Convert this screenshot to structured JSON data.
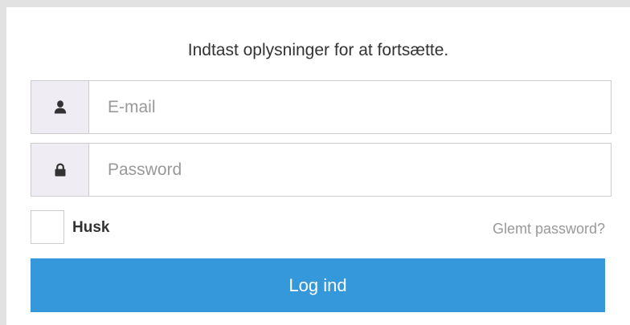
{
  "login": {
    "heading": "Indtast oplysninger for at fortsætte.",
    "email": {
      "placeholder": "E-mail",
      "value": "",
      "icon": "user-icon"
    },
    "password": {
      "placeholder": "Password",
      "value": "",
      "icon": "lock-icon"
    },
    "remember_label": "Husk",
    "remember_checked": false,
    "forgot_label": "Glemt password?",
    "submit_label": "Log ind"
  },
  "colors": {
    "page_background": "#e2e2e2",
    "panel_background": "#ffffff",
    "addon_background": "#efedf3",
    "border": "#cccccc",
    "button": "#3498db",
    "button_text": "#ffffff",
    "muted_text": "#999999",
    "text": "#333333"
  }
}
